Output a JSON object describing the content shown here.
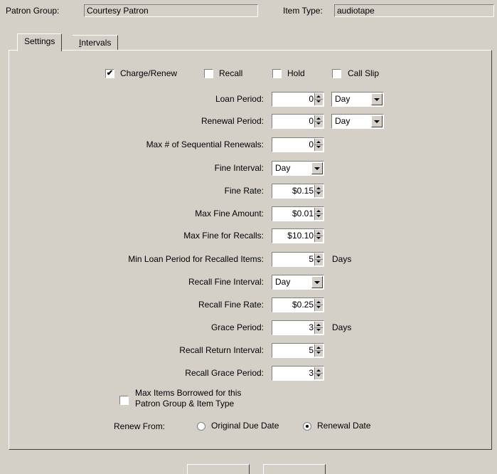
{
  "header": {
    "patron_group_label": "Patron Group:",
    "patron_group_value": "Courtesy Patron",
    "item_type_label": "Item Type:",
    "item_type_value": "audiotape"
  },
  "tabs": [
    {
      "label": "Settings",
      "active": true
    },
    {
      "label": "Intervals",
      "mnemonic": "I",
      "rest": "ntervals",
      "active": false
    }
  ],
  "checkboxes": {
    "charge_renew": {
      "label": "Charge/Renew",
      "checked": true
    },
    "recall": {
      "label": "Recall",
      "checked": false
    },
    "hold": {
      "label": "Hold",
      "checked": false
    },
    "call_slip": {
      "label": "Call Slip",
      "checked": false
    }
  },
  "fields": {
    "loan_period": {
      "label": "Loan Period:",
      "value": "0",
      "unit_select": "Day"
    },
    "renewal_period": {
      "label": "Renewal Period:",
      "value": "0",
      "unit_select": "Day"
    },
    "max_sequential_renewals": {
      "label": "Max # of Sequential Renewals:",
      "value": "0"
    },
    "fine_interval": {
      "label": "Fine Interval:",
      "select": "Day"
    },
    "fine_rate": {
      "label": "Fine Rate:",
      "value": "$0.15"
    },
    "max_fine_amount": {
      "label": "Max Fine Amount:",
      "value": "$0.01"
    },
    "max_fine_recalls": {
      "label": "Max Fine for Recalls:",
      "value": "$10.10"
    },
    "min_loan_recalled": {
      "label": "Min Loan Period for Recalled Items:",
      "value": "5",
      "unit": "Days"
    },
    "recall_fine_interval": {
      "label": "Recall Fine Interval:",
      "select": "Day"
    },
    "recall_fine_rate": {
      "label": "Recall Fine Rate:",
      "value": "$0.25"
    },
    "grace_period": {
      "label": "Grace Period:",
      "value": "3",
      "unit": "Days"
    },
    "recall_return_interval": {
      "label": "Recall Return Interval:",
      "value": "5"
    },
    "recall_grace_period": {
      "label": "Recall Grace Period:",
      "value": "3"
    }
  },
  "max_items": {
    "line1": "Max Items Borrowed for this",
    "line2": "Patron Group & Item Type",
    "checked": false
  },
  "renew_from": {
    "label": "Renew From:",
    "options": [
      {
        "label": "Original Due Date",
        "selected": false
      },
      {
        "label": "Renewal Date",
        "selected": true
      }
    ]
  }
}
